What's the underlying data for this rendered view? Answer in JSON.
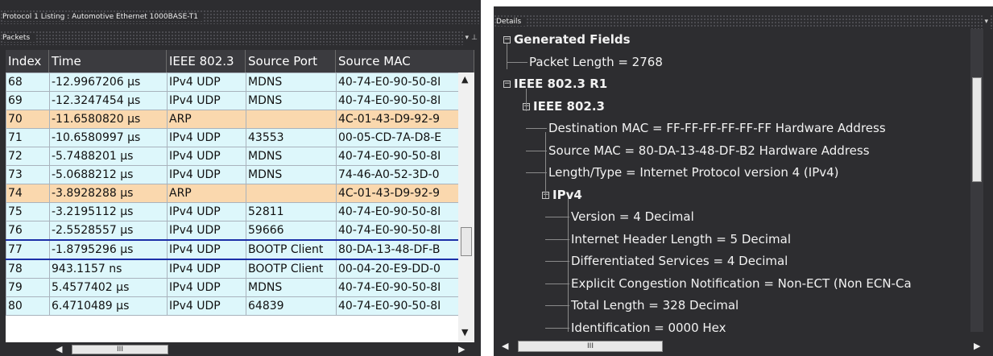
{
  "left_panel": {
    "window_title": "Protocol 1 Listing : Automotive Ethernet 1000BASE-T1",
    "packets_title": "Packets",
    "pin_glyph": "⊥",
    "dropdown_glyph": "▾",
    "columns": [
      "Index",
      "Time",
      "IEEE 802.3",
      "Source Port",
      "Source MAC"
    ],
    "rows": [
      {
        "index": "68",
        "time": "-12.9967206 µs",
        "ieee": "IPv4 UDP",
        "port": "MDNS",
        "mac": "40-74-E0-90-50-8I",
        "kind": "udp"
      },
      {
        "index": "69",
        "time": "-12.3247454 µs",
        "ieee": "IPv4 UDP",
        "port": "MDNS",
        "mac": "40-74-E0-90-50-8I",
        "kind": "udp"
      },
      {
        "index": "70",
        "time": "-11.6580820 µs",
        "ieee": "ARP",
        "port": "",
        "mac": "4C-01-43-D9-92-9",
        "kind": "arp"
      },
      {
        "index": "71",
        "time": "-10.6580997 µs",
        "ieee": "IPv4 UDP",
        "port": "43553",
        "mac": "00-05-CD-7A-D8-E",
        "kind": "udp"
      },
      {
        "index": "72",
        "time": "-5.7488201 µs",
        "ieee": "IPv4 UDP",
        "port": "MDNS",
        "mac": "40-74-E0-90-50-8I",
        "kind": "udp"
      },
      {
        "index": "73",
        "time": "-5.0688212 µs",
        "ieee": "IPv4 UDP",
        "port": "MDNS",
        "mac": "74-46-A0-52-3D-0",
        "kind": "udp"
      },
      {
        "index": "74",
        "time": "-3.8928288 µs",
        "ieee": "ARP",
        "port": "",
        "mac": "4C-01-43-D9-92-9",
        "kind": "arp"
      },
      {
        "index": "75",
        "time": "-3.2195112 µs",
        "ieee": "IPv4 UDP",
        "port": "52811",
        "mac": "40-74-E0-90-50-8I",
        "kind": "udp"
      },
      {
        "index": "76",
        "time": "-2.5528557 µs",
        "ieee": "IPv4 UDP",
        "port": "59666",
        "mac": "40-74-E0-90-50-8I",
        "kind": "udp"
      },
      {
        "index": "77",
        "time": "-1.8795296 µs",
        "ieee": "IPv4 UDP",
        "port": "BOOTP Client",
        "mac": "80-DA-13-48-DF-B",
        "kind": "udp",
        "selected": true
      },
      {
        "index": "78",
        "time": "943.1157 ns",
        "ieee": "IPv4 UDP",
        "port": "BOOTP Client",
        "mac": "00-04-20-E9-DD-0",
        "kind": "udp"
      },
      {
        "index": "79",
        "time": "5.4577402 µs",
        "ieee": "IPv4 UDP",
        "port": "MDNS",
        "mac": "40-74-E0-90-50-8I",
        "kind": "udp"
      },
      {
        "index": "80",
        "time": "6.4710489 µs",
        "ieee": "IPv4 UDP",
        "port": "64839",
        "mac": "40-74-E0-90-50-8I",
        "kind": "udp"
      }
    ],
    "scroll_left": "◀",
    "scroll_right": "▶",
    "scroll_up": "▲",
    "scroll_down": "▼",
    "thumb_grip": "III"
  },
  "right_panel": {
    "title": "Details",
    "dropdown_glyph": "▾",
    "tree": [
      {
        "text": "Generated Fields",
        "level": 0,
        "bold": true,
        "expander": "−"
      },
      {
        "text": "Packet Length = 2768",
        "level": 1,
        "bold": false
      },
      {
        "text": "IEEE 802.3 R1",
        "level": 0,
        "bold": true,
        "expander": "−"
      },
      {
        "text": "IEEE 802.3",
        "level": 1,
        "bold": true,
        "expander": "−"
      },
      {
        "text": "Destination MAC = FF-FF-FF-FF-FF-FF Hardware Address",
        "level": 2,
        "bold": false
      },
      {
        "text": "Source MAC = 80-DA-13-48-DF-B2 Hardware Address",
        "level": 2,
        "bold": false
      },
      {
        "text": "Length/Type = Internet Protocol version 4 (IPv4)",
        "level": 2,
        "bold": false
      },
      {
        "text": "IPv4",
        "level": 2,
        "bold": true,
        "expander": "−"
      },
      {
        "text": "Version = 4 Decimal",
        "level": 3,
        "bold": false
      },
      {
        "text": "Internet Header Length = 5 Decimal",
        "level": 3,
        "bold": false
      },
      {
        "text": "Differentiated Services = 4 Decimal",
        "level": 3,
        "bold": false
      },
      {
        "text": "Explicit Congestion Notification = Non-ECT (Non ECN-Ca",
        "level": 3,
        "bold": false
      },
      {
        "text": "Total Length = 328 Decimal",
        "level": 3,
        "bold": false
      },
      {
        "text": "Identification = 0000 Hex",
        "level": 3,
        "bold": false
      }
    ],
    "scroll_left": "◀",
    "scroll_right": "▶",
    "thumb_grip": "III"
  },
  "colors": {
    "udp_row": "#ddf7fb",
    "arp_row": "#fad8ae",
    "selection_border": "#1c2fa8",
    "panel_bg": "#2d2d30"
  }
}
